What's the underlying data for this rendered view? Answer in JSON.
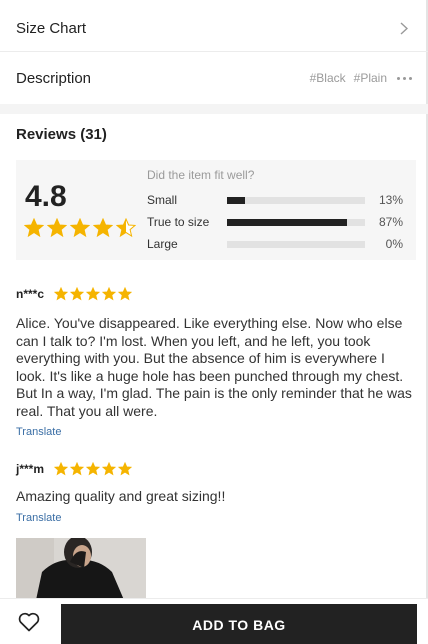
{
  "size_chart": {
    "label": "Size Chart"
  },
  "description": {
    "label": "Description",
    "tags": [
      "#Black",
      "#Plain"
    ]
  },
  "reviews": {
    "title": "Reviews (31)"
  },
  "summary": {
    "rating": "4.8",
    "stars": 4.5,
    "fit_question": "Did the item fit well?",
    "fit": [
      {
        "label": "Small",
        "pct_text": "13%",
        "value": 0.13
      },
      {
        "label": "True to size",
        "pct_text": "87%",
        "value": 0.87
      },
      {
        "label": "Large",
        "pct_text": "0%",
        "value": 0
      }
    ]
  },
  "review_list": [
    {
      "name": "n***c",
      "stars": 5,
      "text": "Alice. You've disappeared. Like everything else. Now who else can I talk to? I'm lost. When you left, and he left, you took everything with you. But the absence of him is everywhere I look. It's like a huge hole has been punched through my chest. But In a way, I'm glad. The pain is the only reminder that he was real. That you all were.",
      "translate": "Translate"
    },
    {
      "name": "j***m",
      "stars": 5,
      "text": "Amazing quality and great sizing!!",
      "translate": "Translate"
    }
  ],
  "bottom_bar": {
    "add_label": "ADD TO BAG"
  },
  "colors": {
    "star": "#f5b400",
    "primary": "#222222",
    "link": "#3a6ea5"
  }
}
